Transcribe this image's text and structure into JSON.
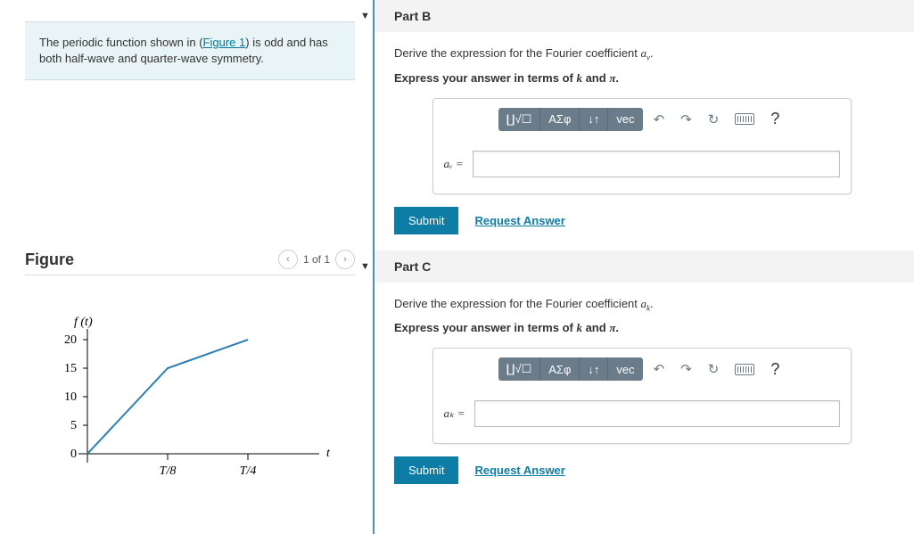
{
  "intro": {
    "text_before_link": "The periodic function shown in (",
    "link_text": "Figure 1",
    "text_after_link": ") is odd and has both half-wave and quarter-wave symmetry."
  },
  "figure": {
    "title": "Figure",
    "page": "1 of 1",
    "y_label": "f (t)",
    "x_label": "t",
    "y_ticks": [
      "0",
      "5",
      "10",
      "15",
      "20"
    ],
    "x_ticks": [
      "T/8",
      "T/4"
    ]
  },
  "toolbar": {
    "templates": "∐√☐",
    "greek": "ΑΣφ",
    "subsup": "↓↑",
    "vec": "vec",
    "undo": "↶",
    "redo": "↷",
    "reset": "↻",
    "help": "?"
  },
  "partB": {
    "header": "Part B",
    "prompt": "Derive the expression for the Fourier coefficient ",
    "coef": "a",
    "subscript": "v",
    "prompt_end": ".",
    "instruction_a": "Express your answer in terms of ",
    "var1": "k",
    "instruction_b": " and ",
    "var2": "π",
    "instruction_c": ".",
    "label": "aᵥ =",
    "submit": "Submit",
    "request": "Request Answer"
  },
  "partC": {
    "header": "Part C",
    "prompt": "Derive the expression for the Fourier coefficient ",
    "coef": "a",
    "subscript": "k",
    "prompt_end": ".",
    "instruction_a": "Express your answer in terms of ",
    "var1": "k",
    "instruction_b": " and ",
    "var2": "π",
    "instruction_c": ".",
    "label": "aₖ =",
    "submit": "Submit",
    "request": "Request Answer"
  },
  "chart_data": {
    "type": "line",
    "x_units": "fraction of T",
    "series": [
      {
        "name": "f(t)",
        "points": [
          {
            "x": 0,
            "y": 0
          },
          {
            "x": 0.125,
            "y": 15
          },
          {
            "x": 0.25,
            "y": 20
          }
        ]
      }
    ],
    "y_ticks": [
      0,
      5,
      10,
      15,
      20
    ],
    "x_tick_labels": [
      "T/8",
      "T/4"
    ],
    "ylim": [
      0,
      22
    ],
    "xlim": [
      0,
      0.31
    ],
    "y_label": "f (t)",
    "x_label": "t"
  }
}
